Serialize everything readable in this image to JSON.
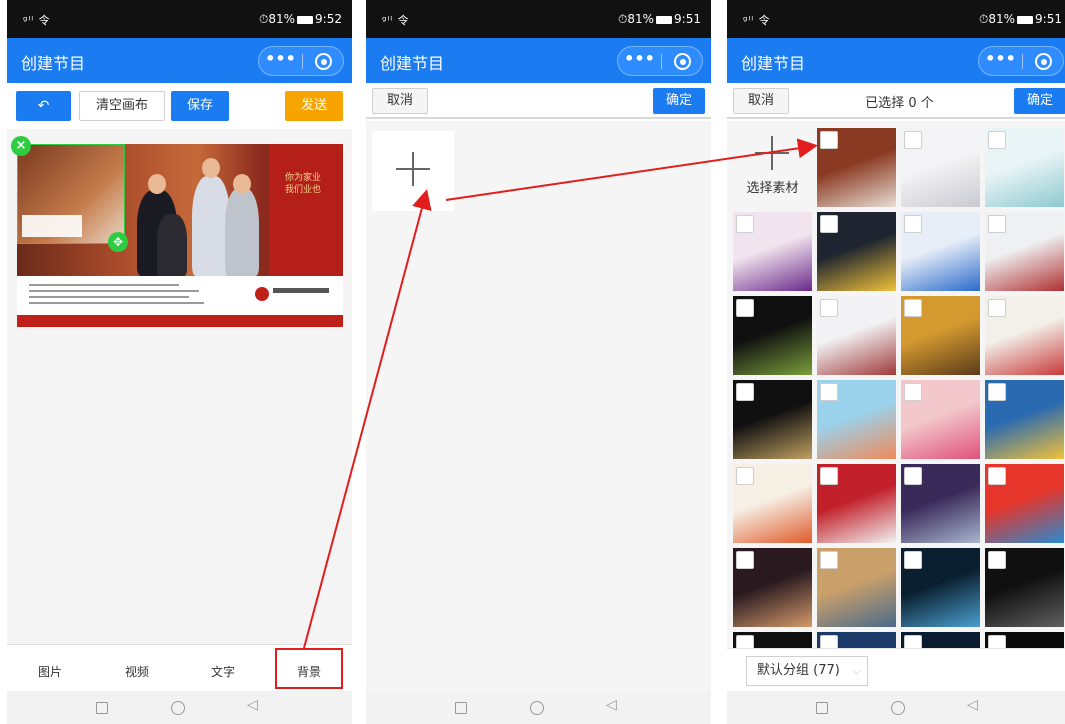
{
  "status_bar": {
    "signal": "ᵍˡˡ 令",
    "time_1": "9:52",
    "time_2": "9:51",
    "time_3": "9:51",
    "battery": "81%",
    "alarm": "⏱"
  },
  "app_title": "创建节目",
  "capsule": {
    "more": "•••"
  },
  "screen1": {
    "undo_icon": "↶",
    "clear_label": "清空画布",
    "save_label": "保存",
    "send_label": "发送",
    "tabs": [
      "图片",
      "视频",
      "文字",
      "背景"
    ],
    "poster_red_text": "你为家业 我们业也",
    "close_glyph": "×",
    "move_glyph": "✥"
  },
  "screen2": {
    "cancel_label": "取消",
    "confirm_label": "确定"
  },
  "screen3": {
    "cancel_label": "取消",
    "selected_count": "已选择 0 个",
    "confirm_label": "确定",
    "select_material_label": "选择素材",
    "group_label": "默认分组 (77)",
    "chevron": "⌵"
  },
  "nav": {
    "back": "◁"
  },
  "colors": {
    "accent": "#1b7cf2",
    "send": "#f7a300",
    "highlight": "#e11d1d",
    "selection": "#2ecc40"
  },
  "thumbnails": [
    {
      "c1": "#8a3a22",
      "c2": "#e8ddd4"
    },
    {
      "c1": "#f4f4f6",
      "c2": "#c9c9d1"
    },
    {
      "c1": "#e9f4f6",
      "c2": "#8dc9d1"
    },
    {
      "c1": "#f2e4ee",
      "c2": "#6a2a8a"
    },
    {
      "c1": "#1e2530",
      "c2": "#f1c23a"
    },
    {
      "c1": "#e7eef8",
      "c2": "#2a6acb"
    },
    {
      "c1": "#eef0f2",
      "c2": "#b03030"
    },
    {
      "c1": "#101010",
      "c2": "#7aa03a"
    },
    {
      "c1": "#f2f2f4",
      "c2": "#a03a3a"
    },
    {
      "c1": "#d49a30",
      "c2": "#5a3a1a"
    },
    {
      "c1": "#f3f0ea",
      "c2": "#c83a3a"
    },
    {
      "c1": "#101010",
      "c2": "#c0a060"
    },
    {
      "c1": "#9ad2ec",
      "c2": "#f08a5a"
    },
    {
      "c1": "#f2c8cc",
      "c2": "#e0507a"
    },
    {
      "c1": "#2a6ab0",
      "c2": "#f2c23a"
    },
    {
      "c1": "#f6efe4",
      "c2": "#e05a2a"
    },
    {
      "c1": "#c2202a",
      "c2": "#f2f2f2"
    },
    {
      "c1": "#3a2a5a",
      "c2": "#a8b6d0"
    },
    {
      "c1": "#e6352a",
      "c2": "#2a8ad0"
    },
    {
      "c1": "#2a1a20",
      "c2": "#d49a6a"
    },
    {
      "c1": "#caa06a",
      "c2": "#4a6a8a"
    },
    {
      "c1": "#0a2030",
      "c2": "#4aa0d0"
    },
    {
      "c1": "#101010",
      "c2": "#606060"
    },
    {
      "c1": "#101010",
      "c2": "#303030"
    },
    {
      "c1": "#1a3a6a",
      "c2": "#2a2a2a"
    },
    {
      "c1": "#0a1a30",
      "c2": "#2a4a7a"
    },
    {
      "c1": "#0a0a0a",
      "c2": "#1a2a3a"
    }
  ]
}
